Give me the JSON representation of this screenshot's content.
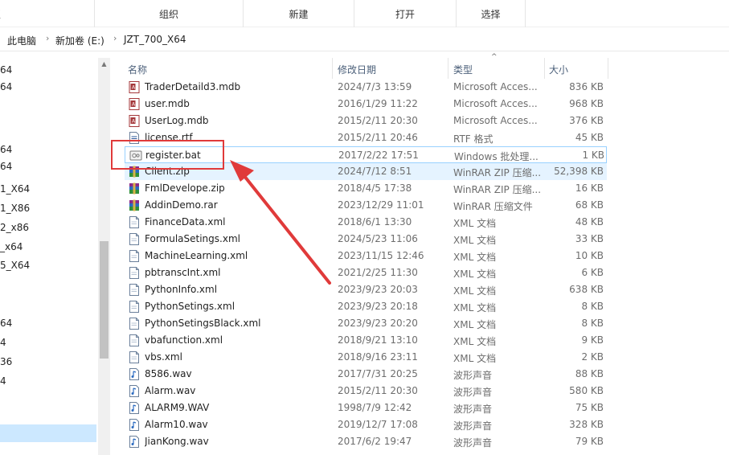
{
  "ribbon": {
    "groups": [
      {
        "label": "板"
      },
      {
        "label": "组织"
      },
      {
        "label": "新建"
      },
      {
        "label": "打开"
      },
      {
        "label": "选择"
      }
    ]
  },
  "address": {
    "crumbs": [
      "此电脑",
      "新加卷 (E:)",
      "JZT_700_X64"
    ],
    "separator": "›"
  },
  "nav": {
    "items": [
      "64",
      "64",
      "",
      "",
      "64",
      "64",
      "1_X64",
      "1_X86",
      "2_x86",
      "_x64",
      "5_X64",
      "",
      "",
      "64",
      "4",
      "36",
      "4"
    ]
  },
  "columns": {
    "name": "名称",
    "date": "修改日期",
    "type": "类型",
    "size": "大小"
  },
  "files": [
    {
      "name": "TraderDetaild3.mdb",
      "date": "2024/7/3 13:59",
      "type": "Microsoft Acces...",
      "size": "836 KB",
      "icon": "access-db-icon"
    },
    {
      "name": "user.mdb",
      "date": "2016/1/29 11:22",
      "type": "Microsoft Acces...",
      "size": "968 KB",
      "icon": "access-db-icon"
    },
    {
      "name": "UserLog.mdb",
      "date": "2015/2/11 20:30",
      "type": "Microsoft Acces...",
      "size": "376 KB",
      "icon": "access-db-icon"
    },
    {
      "name": "license.rtf",
      "date": "2015/2/11 20:46",
      "type": "RTF 格式",
      "size": "45 KB",
      "icon": "rtf-document-icon"
    },
    {
      "name": "register.bat",
      "date": "2017/2/22 17:51",
      "type": "Windows 批处理...",
      "size": "1 KB",
      "icon": "batch-file-icon"
    },
    {
      "name": "Client.zip",
      "date": "2024/7/12 8:51",
      "type": "WinRAR ZIP 压缩...",
      "size": "52,398 KB",
      "icon": "winrar-archive-icon"
    },
    {
      "name": "FmlDevelope.zip",
      "date": "2018/4/5 17:38",
      "type": "WinRAR ZIP 压缩...",
      "size": "16 KB",
      "icon": "winrar-archive-icon"
    },
    {
      "name": "AddinDemo.rar",
      "date": "2023/12/29 11:01",
      "type": "WinRAR 压缩文件",
      "size": "68 KB",
      "icon": "winrar-archive-icon"
    },
    {
      "name": "FinanceData.xml",
      "date": "2018/6/1 13:30",
      "type": "XML 文档",
      "size": "48 KB",
      "icon": "xml-document-icon"
    },
    {
      "name": "FormulaSetings.xml",
      "date": "2024/5/23 11:06",
      "type": "XML 文档",
      "size": "33 KB",
      "icon": "xml-document-icon"
    },
    {
      "name": "MachineLearning.xml",
      "date": "2023/11/15 12:46",
      "type": "XML 文档",
      "size": "10 KB",
      "icon": "xml-document-icon"
    },
    {
      "name": "pbtranscInt.xml",
      "date": "2021/2/25 11:30",
      "type": "XML 文档",
      "size": "6 KB",
      "icon": "xml-document-icon"
    },
    {
      "name": "PythonInfo.xml",
      "date": "2023/9/23 20:03",
      "type": "XML 文档",
      "size": "638 KB",
      "icon": "xml-document-icon"
    },
    {
      "name": "PythonSetings.xml",
      "date": "2023/9/23 20:18",
      "type": "XML 文档",
      "size": "8 KB",
      "icon": "xml-document-icon"
    },
    {
      "name": "PythonSetingsBlack.xml",
      "date": "2023/9/23 20:20",
      "type": "XML 文档",
      "size": "8 KB",
      "icon": "xml-document-icon"
    },
    {
      "name": "vbafunction.xml",
      "date": "2018/9/21 13:10",
      "type": "XML 文档",
      "size": "9 KB",
      "icon": "xml-document-icon"
    },
    {
      "name": "vbs.xml",
      "date": "2018/9/16 23:11",
      "type": "XML 文档",
      "size": "2 KB",
      "icon": "xml-document-icon"
    },
    {
      "name": "8586.wav",
      "date": "2017/7/31 20:25",
      "type": "波形声音",
      "size": "88 KB",
      "icon": "audio-file-icon"
    },
    {
      "name": "Alarm.wav",
      "date": "2015/2/11 20:30",
      "type": "波形声音",
      "size": "580 KB",
      "icon": "audio-file-icon"
    },
    {
      "name": "ALARM9.WAV",
      "date": "1998/7/9 12:42",
      "type": "波形声音",
      "size": "75 KB",
      "icon": "audio-file-icon"
    },
    {
      "name": "Alarm10.wav",
      "date": "2019/12/7 17:08",
      "type": "波形声音",
      "size": "328 KB",
      "icon": "audio-file-icon"
    },
    {
      "name": "JianKong.wav",
      "date": "2017/6/2 19:47",
      "type": "波形声音",
      "size": "79 KB",
      "icon": "audio-file-icon"
    }
  ],
  "selected_file": "register.bat",
  "hover_file": "Client.zip",
  "colors": {
    "annotation": "#e03a3a",
    "selection": "#cce8ff",
    "hover": "#e5f3ff",
    "header_text": "#4c607a"
  }
}
